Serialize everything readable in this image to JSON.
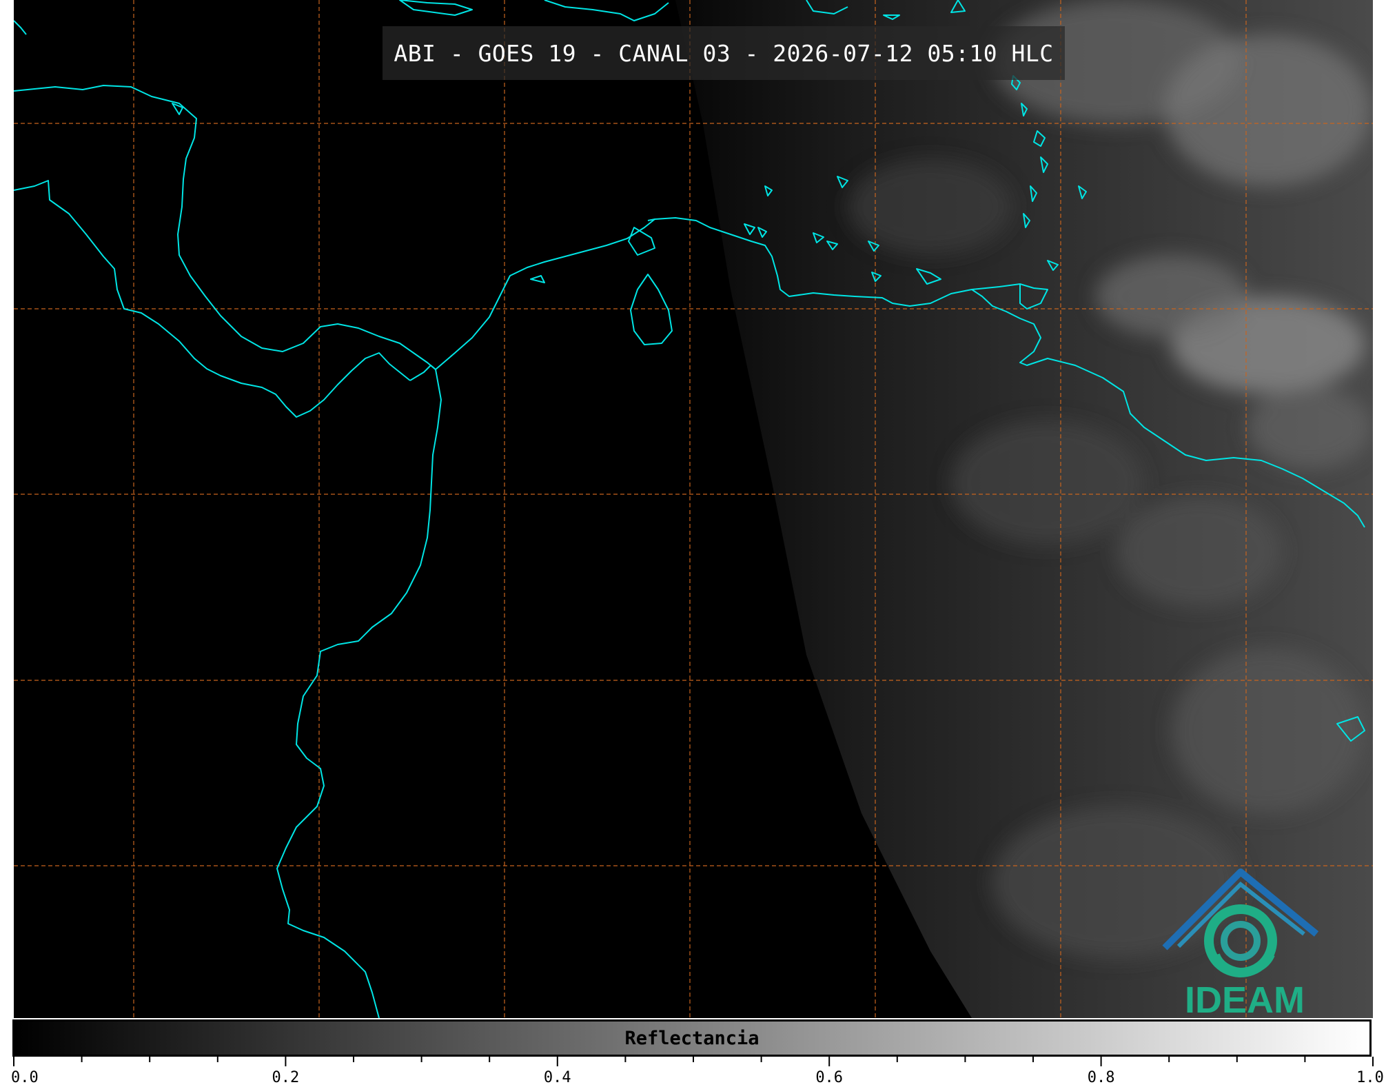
{
  "title": "ABI - GOES 19 - CANAL 03 - 2026-07-12 05:10 HLC",
  "colorbar": {
    "label": "Reflectancia",
    "min": 0.0,
    "max": 1.0,
    "ticks": [
      "0.0",
      "0.2",
      "0.4",
      "0.6",
      "0.8",
      "1.0"
    ],
    "minor_tick_step": 0.05
  },
  "logo": {
    "text": "IDEAM"
  },
  "colors": {
    "coastline": "#00e5e5",
    "grid": "#c8641e",
    "title_background": "#282828",
    "logo_green": "#1fae86",
    "logo_blue": "#1e6eb4"
  },
  "layers": [
    "coastline-icon",
    "graticule-grid",
    "cloud-reflectance"
  ]
}
